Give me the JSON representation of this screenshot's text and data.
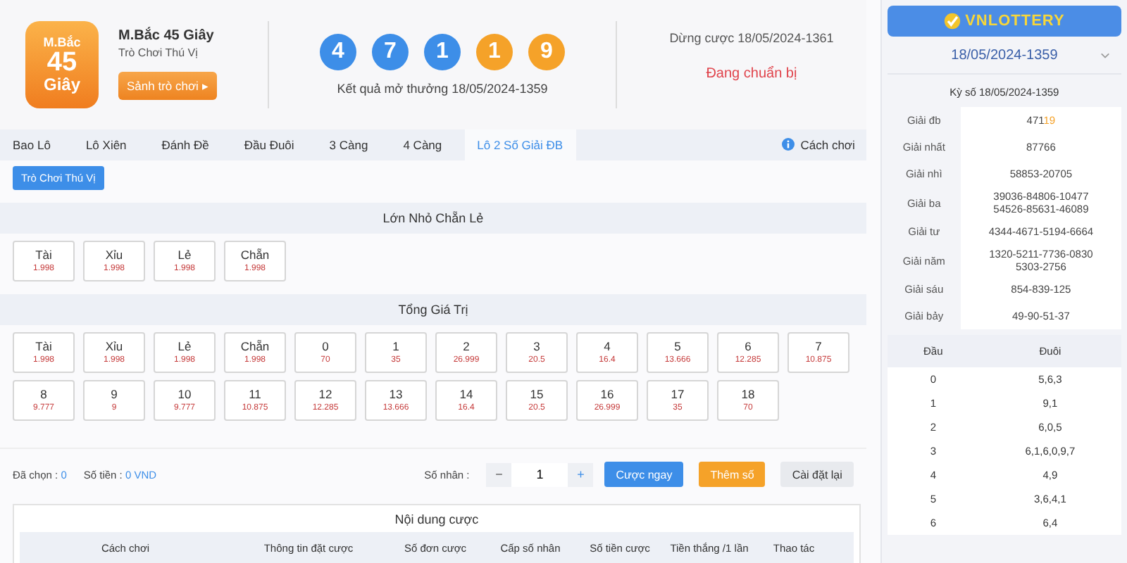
{
  "header": {
    "logo_text": [
      "M.Bắc",
      "45",
      "Giây"
    ],
    "title": "M.Bắc 45 Giây",
    "subtitle": "Trò Chơi Thú Vị",
    "lobby_button": "Sảnh trò chơi ▸",
    "balls": [
      {
        "value": "4",
        "color": "#3d8ee8"
      },
      {
        "value": "7",
        "color": "#3d8ee8"
      },
      {
        "value": "1",
        "color": "#3d8ee8"
      },
      {
        "value": "1",
        "color": "#f5a229"
      },
      {
        "value": "9",
        "color": "#f5a229"
      }
    ],
    "result_caption": "Kết quả mở thưởng 18/05/2024-1359",
    "stop_text": "Dừng cược 18/05/2024-1361",
    "status": "Đang chuẩn bị"
  },
  "tabs": [
    {
      "label": "Bao Lô",
      "selected": false
    },
    {
      "label": "Lô Xiên",
      "selected": false
    },
    {
      "label": "Đánh Đề",
      "selected": false
    },
    {
      "label": "Đầu Đuôi",
      "selected": false
    },
    {
      "label": "3 Càng",
      "selected": false
    },
    {
      "label": "4 Càng",
      "selected": false
    },
    {
      "label": "Lô 2 Số Giải ĐB",
      "selected": true
    }
  ],
  "how_to_play": "Cách chơi",
  "subtab": "Trò Chơi Thú Vị",
  "sections": [
    {
      "title": "Lớn Nhỏ Chẵn Lẻ",
      "options": [
        {
          "label": "Tài",
          "odds": "1.998"
        },
        {
          "label": "Xỉu",
          "odds": "1.998"
        },
        {
          "label": "Lẻ",
          "odds": "1.998"
        },
        {
          "label": "Chẵn",
          "odds": "1.998"
        }
      ]
    },
    {
      "title": "Tổng Giá Trị",
      "options": [
        {
          "label": "Tài",
          "odds": "1.998"
        },
        {
          "label": "Xỉu",
          "odds": "1.998"
        },
        {
          "label": "Lẻ",
          "odds": "1.998"
        },
        {
          "label": "Chẵn",
          "odds": "1.998"
        },
        {
          "label": "0",
          "odds": "70"
        },
        {
          "label": "1",
          "odds": "35"
        },
        {
          "label": "2",
          "odds": "26.999"
        },
        {
          "label": "3",
          "odds": "20.5"
        },
        {
          "label": "4",
          "odds": "16.4"
        },
        {
          "label": "5",
          "odds": "13.666"
        },
        {
          "label": "6",
          "odds": "12.285"
        },
        {
          "label": "7",
          "odds": "10.875"
        },
        {
          "label": "8",
          "odds": "9.777"
        },
        {
          "label": "9",
          "odds": "9"
        },
        {
          "label": "10",
          "odds": "9.777"
        },
        {
          "label": "11",
          "odds": "10.875"
        },
        {
          "label": "12",
          "odds": "12.285"
        },
        {
          "label": "13",
          "odds": "13.666"
        },
        {
          "label": "14",
          "odds": "16.4"
        },
        {
          "label": "15",
          "odds": "20.5"
        },
        {
          "label": "16",
          "odds": "26.999"
        },
        {
          "label": "17",
          "odds": "35"
        },
        {
          "label": "18",
          "odds": "70"
        }
      ]
    }
  ],
  "bet_bar": {
    "selected_label": "Đã chọn :",
    "selected_value": "0",
    "amount_label": "Số tiền :",
    "amount_value": "0 VND",
    "multiplier_label": "Số nhân :",
    "minus": "−",
    "multiplier": "1",
    "plus": "+",
    "buttons": [
      {
        "label": "Cược ngay",
        "kind": "primary"
      },
      {
        "label": "Thêm số",
        "kind": "accent"
      },
      {
        "label": "Cài đặt lại",
        "kind": "plain"
      }
    ]
  },
  "bet_table": {
    "title": "Nội dung cược",
    "columns": [
      "Cách chơi",
      "Thông tin đặt cược",
      "Số đơn cược",
      "Cấp số nhân",
      "Số tiền cược",
      "Tiền thắng /1 lần",
      "Thao tác"
    ]
  },
  "sidebar": {
    "brand": "VNLOTTERY",
    "draw_select": "18/05/2024-1359",
    "draw_title": "Kỳ số 18/05/2024-1359",
    "prizes": [
      {
        "name": "Giải đb",
        "lines": [
          "471"
        ],
        "highlight": "19"
      },
      {
        "name": "Giải nhất",
        "lines": [
          "87766"
        ]
      },
      {
        "name": "Giải nhì",
        "lines": [
          "58853-20705"
        ]
      },
      {
        "name": "Giải ba",
        "lines": [
          "39036-84806-10477",
          "54526-85631-46089"
        ]
      },
      {
        "name": "Giải tư",
        "lines": [
          "4344-4671-5194-6664"
        ]
      },
      {
        "name": "Giải năm",
        "lines": [
          "1320-5211-7736-0830",
          "5303-2756"
        ]
      },
      {
        "name": "Giải sáu",
        "lines": [
          "854-839-125"
        ]
      },
      {
        "name": "Giải bảy",
        "lines": [
          "49-90-51-37"
        ]
      }
    ],
    "headtail_columns": [
      "Đầu",
      "Đuôi"
    ],
    "headtail": [
      [
        "0",
        "5,6,3"
      ],
      [
        "1",
        "9,1"
      ],
      [
        "2",
        "6,0,5"
      ],
      [
        "3",
        "6,1,6,0,9,7"
      ],
      [
        "4",
        "4,9"
      ],
      [
        "5",
        "3,6,4,1"
      ],
      [
        "6",
        "6,4"
      ]
    ]
  }
}
